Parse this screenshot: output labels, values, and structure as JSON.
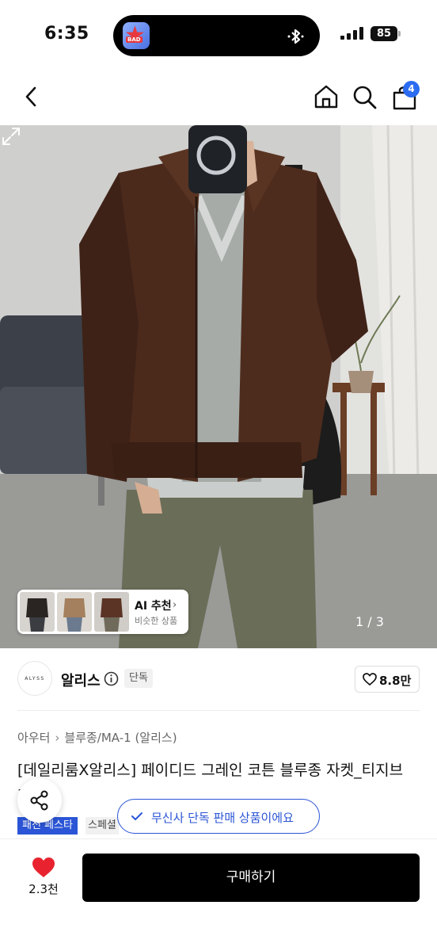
{
  "status_bar": {
    "time": "6:35",
    "battery": "85"
  },
  "header": {
    "cart_count": "4"
  },
  "gallery": {
    "ai_recommend": {
      "title": "AI 추천",
      "subtitle": "비슷한 상품"
    },
    "page_counter": "1 / 3"
  },
  "brand": {
    "logo_text": "ALYSS",
    "name": "알리스",
    "tag": "단독",
    "likes": "8.8만"
  },
  "breadcrumb": [
    "아우터",
    "블루종/MA-1 (알리스)"
  ],
  "product": {
    "title": "[데일리룸X알리스] 페이디드 그레인 코튼 블루종 자켓_티지브라운]"
  },
  "tags": {
    "festa": "패션 페스타",
    "special": "스페셜"
  },
  "toast": {
    "text": "무신사 단독 판매 상품이에요"
  },
  "bottom_bar": {
    "wish_count": "2.3천",
    "buy_label": "구매하기"
  },
  "colors": {
    "accent": "#2b55d6",
    "badge": "#2b6cf0",
    "heart": "#e8232f",
    "buy_bg": "#000000"
  }
}
